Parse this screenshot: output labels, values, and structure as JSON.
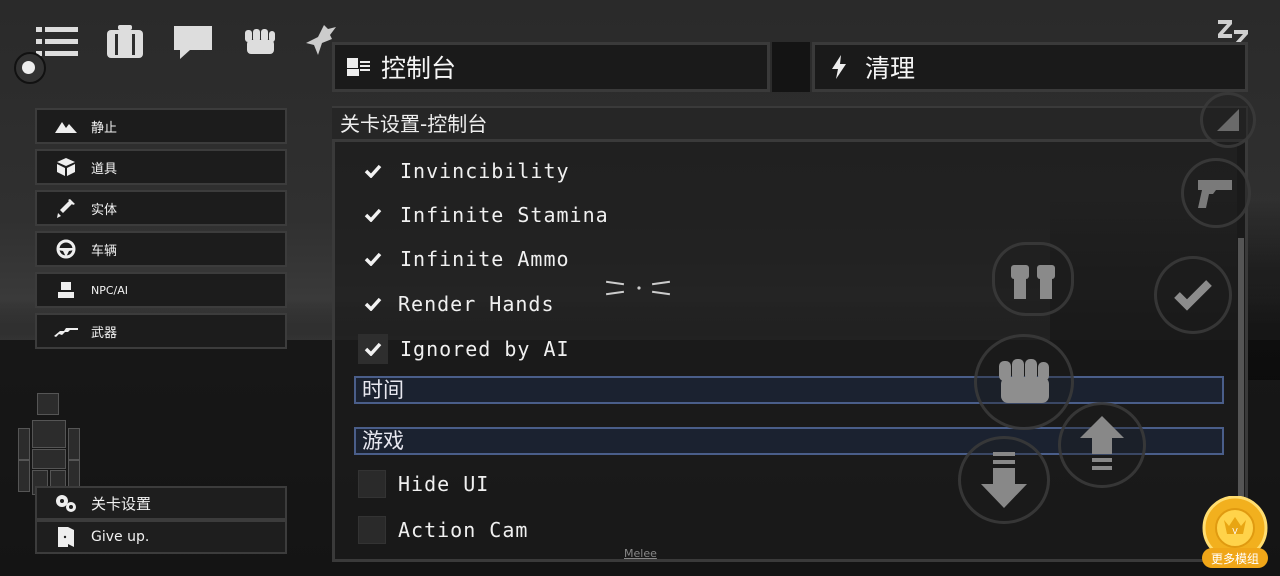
{
  "header": {
    "console_label": "控制台",
    "clear_label": "清理"
  },
  "categories": [
    {
      "label": "静止",
      "icon": "mountain-icon"
    },
    {
      "label": "道具",
      "icon": "box-icon"
    },
    {
      "label": "实体",
      "icon": "syringe-icon"
    },
    {
      "label": "车辆",
      "icon": "steering-wheel-icon"
    },
    {
      "label": "NPC/AI",
      "icon": "npc-icon"
    },
    {
      "label": "武器",
      "icon": "rifle-icon"
    }
  ],
  "bottom_menu": {
    "level_settings": "关卡设置",
    "give_up": "Give up."
  },
  "panel": {
    "title": "关卡设置-控制台",
    "options": [
      {
        "label": "Invincibility",
        "checked": true
      },
      {
        "label": "Infinite Stamina",
        "checked": true
      },
      {
        "label": "Infinite Ammo",
        "checked": true
      },
      {
        "label": "Render Hands",
        "checked": true
      },
      {
        "label": "Ignored by AI",
        "checked": true
      }
    ],
    "section_time": "时间",
    "section_game": "游戏",
    "game_options": [
      {
        "label": "Hide UI",
        "checked": false
      },
      {
        "label": "Action Cam",
        "checked": false
      }
    ]
  },
  "hud": {
    "melee": "Melee",
    "sleep": "ZZZ",
    "mod_badge": "更多模组"
  },
  "colors": {
    "section_border": "#4a5e8a",
    "badge_gold": "#f2b01e"
  }
}
